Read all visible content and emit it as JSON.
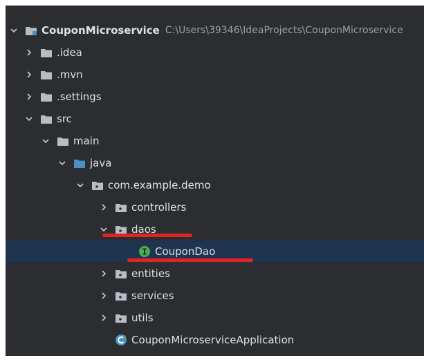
{
  "tree": {
    "rows": [
      {
        "label": "CouponMicroservice",
        "path": "C:\\Users\\39346\\IdeaProjects\\CouponMicroservice",
        "bold": true,
        "expanded": true,
        "icon": "module-folder-icon"
      },
      {
        "label": ".idea",
        "expanded": false,
        "icon": "folder-icon"
      },
      {
        "label": ".mvn",
        "expanded": false,
        "icon": "folder-icon"
      },
      {
        "label": ".settings",
        "expanded": false,
        "icon": "folder-icon"
      },
      {
        "label": "src",
        "expanded": true,
        "icon": "folder-icon"
      },
      {
        "label": "main",
        "expanded": true,
        "icon": "folder-icon"
      },
      {
        "label": "java",
        "expanded": true,
        "icon": "source-root-folder-icon"
      },
      {
        "label": "com.example.demo",
        "expanded": true,
        "icon": "package-icon"
      },
      {
        "label": "controllers",
        "expanded": false,
        "icon": "package-icon"
      },
      {
        "label": "daos",
        "expanded": true,
        "icon": "package-icon"
      },
      {
        "label": "CouponDao",
        "selected": true,
        "icon": "interface-icon"
      },
      {
        "label": "entities",
        "expanded": false,
        "icon": "package-icon"
      },
      {
        "label": "services",
        "expanded": false,
        "icon": "package-icon"
      },
      {
        "label": "utils",
        "expanded": false,
        "icon": "package-icon"
      },
      {
        "label": "CouponMicroserviceApplication",
        "icon": "spring-boot-class-icon"
      }
    ]
  },
  "colors": {
    "background": "#2b2d30",
    "selection": "#1f3450",
    "text": "#dfe1e5",
    "path_text": "#9da0a8",
    "folder": "#b8bcc4",
    "source_root": "#4a90c8",
    "interface_badge": "#4caf50",
    "spring_boot": "#6ab04c",
    "annotation": "#e02424"
  }
}
